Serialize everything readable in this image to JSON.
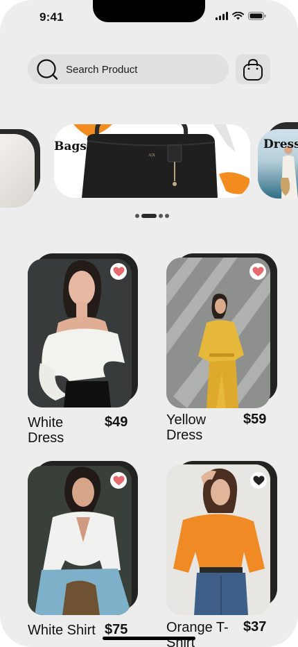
{
  "status": {
    "time": "9:41"
  },
  "search": {
    "placeholder": "Search Product"
  },
  "categories": [
    {
      "label": ""
    },
    {
      "label": "Bags"
    },
    {
      "label": "Dress"
    }
  ],
  "carousel": {
    "active_index": 1,
    "count": 4
  },
  "products": [
    {
      "name": "White Dress",
      "price": "$49",
      "favorited": true
    },
    {
      "name": "Yellow Dress",
      "price": "$59",
      "favorited": true
    },
    {
      "name": "White Shirt",
      "price": "$75",
      "favorited": true
    },
    {
      "name": "Orange T-Shirt",
      "price": "$37",
      "favorited": false
    }
  ],
  "colors": {
    "heart_active": "#e56b6f",
    "heart_inactive": "#222222",
    "background": "#ededed"
  }
}
